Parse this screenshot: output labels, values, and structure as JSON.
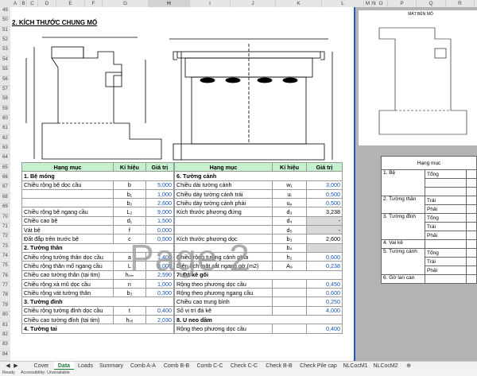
{
  "columns": [
    "A",
    "B",
    "C",
    "D",
    "E",
    "F",
    "G",
    "H",
    "I",
    "J",
    "K",
    "L",
    "M",
    "N",
    "O",
    "P",
    "Q",
    "R",
    "S"
  ],
  "rows": [
    "49",
    "50",
    "51",
    "52",
    "53",
    "54",
    "55",
    "56",
    "57",
    "58",
    "59",
    "60",
    "61",
    "62",
    "63",
    "64",
    "65",
    "66",
    "67",
    "68",
    "69",
    "70",
    "71",
    "72",
    "73",
    "74",
    "75",
    "76",
    "77",
    "78",
    "79",
    "80",
    "81",
    "82",
    "83",
    "84"
  ],
  "section_title": "2. KÍCH THƯỚC CHUNG MỐ",
  "left_table": {
    "headers": [
      "Hạng mục",
      "Kí hiệu",
      "Giá trị"
    ],
    "rows": [
      {
        "type": "group",
        "label": "1. Bệ móng"
      },
      {
        "label": "Chiều rộng bệ dọc cầu",
        "sym": "b",
        "val": "5,000"
      },
      {
        "label": "",
        "sym": "b₁",
        "val": "1,000"
      },
      {
        "label": "",
        "sym": "b₂",
        "val": "2,600"
      },
      {
        "label": "Chiều rộng bệ ngang cầu",
        "sym": "L₂",
        "val": "9,000"
      },
      {
        "label": "Chiều cao bệ",
        "sym": "d₁",
        "val": "1,500"
      },
      {
        "label": "Vát bệ",
        "sym": "f",
        "val": "0,000"
      },
      {
        "label": "Đất đắp trên trước bệ",
        "sym": "c",
        "val": "0,500"
      },
      {
        "type": "group",
        "label": "2. Tường thân"
      },
      {
        "label": "Chiều rộng tường thân dọc cầu",
        "sym": "a",
        "val": "1,400"
      },
      {
        "label": "Chiều rộng thân mố ngang cầu",
        "sym": "L",
        "val": "9,000"
      },
      {
        "label": "Chiều cao tường thân (tại tim)",
        "sym": "hₜₘ",
        "val": "2,590"
      },
      {
        "label": "Chiều rộng xà mũ dọc cầu",
        "sym": "n",
        "val": "1,000"
      },
      {
        "label": "Chiều rộng vát tường thân",
        "sym": "b₃",
        "val": "0,300"
      },
      {
        "type": "group",
        "label": "3. Tường đỉnh"
      },
      {
        "label": "Chiều rộng tường đỉnh dọc cầu",
        "sym": "t",
        "val": "0,400"
      },
      {
        "label": "Chiều cao tường đỉnh (tại tim)",
        "sym": "hₜₑ",
        "val": "2,030"
      },
      {
        "type": "group",
        "label": "4. Tường tai"
      }
    ]
  },
  "right_table": {
    "headers": [
      "Hạng mục",
      "Kí hiệu",
      "Giá trị"
    ],
    "rows": [
      {
        "type": "group",
        "label": "6. Tường cánh"
      },
      {
        "label": "Chiều dài tường cánh",
        "sym": "w₁",
        "val": "3,000"
      },
      {
        "label": "Chiều dày tường cánh trái",
        "sym": "uᵢ",
        "val": "0,500"
      },
      {
        "label": "Chiều dày tường cánh phải",
        "sym": "uₚ",
        "val": "0,500"
      },
      {
        "label": "Kích thước phương đứng",
        "sym": "d₃",
        "val": "3,238",
        "black": true
      },
      {
        "label": "",
        "sym": "d₄",
        "val": "-",
        "black": true,
        "gray": true
      },
      {
        "label": "",
        "sym": "d₅",
        "val": "-",
        "black": true,
        "gray": true
      },
      {
        "label": "Kích thước phương dọc",
        "sym": "b₃",
        "val": "2,600",
        "black": true
      },
      {
        "label": "",
        "sym": "b₄",
        "val": "",
        "gray": true
      },
      {
        "label": "Chiều rộng tường cánh phía",
        "sym": "h₂",
        "val": "0,600"
      },
      {
        "label": "Diện tích mặt cắt ngang gờ (m2)",
        "sym": "A₉",
        "val": "0,238"
      },
      {
        "type": "group",
        "label": "7. Đá kê gối"
      },
      {
        "label": "Rộng theo phương dọc cầu",
        "sym": "",
        "val": "0,450"
      },
      {
        "label": "Rộng theo phương ngang cầu",
        "sym": "",
        "val": "0,600"
      },
      {
        "label": "Chiều cao trung bình",
        "sym": "",
        "val": "0,250"
      },
      {
        "label": "Số vị trí đá kê",
        "sym": "",
        "val": "4,000"
      },
      {
        "type": "group",
        "label": "8. U neo dầm"
      },
      {
        "label": "Rộng theo phương dọc cầu",
        "sym": "",
        "val": "0,400"
      }
    ]
  },
  "watermark": "Page 2",
  "right_panel": {
    "drawing_title": "MẶT BÊN MỐ",
    "header": "Hạng mục",
    "items": [
      "1. Bệ",
      "2. Tường thân",
      "3. Tường đỉnh",
      "4. Vai kê",
      "5. Tường cánh",
      "6. Gờ lan can"
    ],
    "sub": [
      "Tổng",
      "Trái",
      "Phải",
      "Tổng",
      "Trái",
      "Phải",
      "Tổng",
      "Trái",
      "Phải"
    ]
  },
  "tabs": [
    "Cover",
    "Data",
    "Loads",
    "Summary",
    "Comb A-A",
    "Comb B-B",
    "Comb C-C",
    "Check C-C",
    "Check B-B",
    "Check Pile cap",
    "NLCocM1",
    "NLCocM2"
  ],
  "active_tab": "Data",
  "status": {
    "ready": "Ready",
    "accessibility": "Accessibility: Unavailable"
  },
  "colors": {
    "header_green": "#c6efce",
    "accent_blue": "#1e5bc6",
    "value_blue": "#1a55b8",
    "tab_green": "#1a7a3a"
  }
}
